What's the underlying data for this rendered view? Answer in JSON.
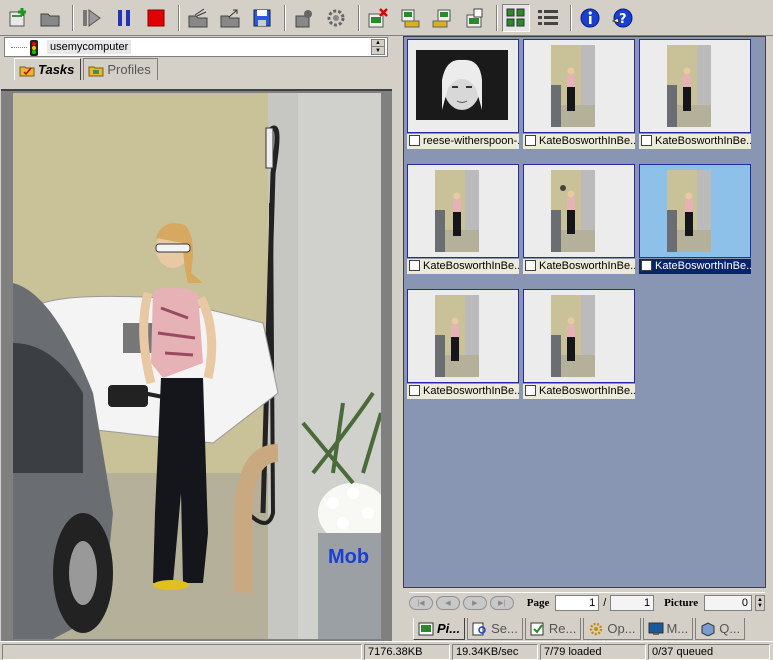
{
  "toolbar": {
    "icons": [
      "new-task-icon",
      "open-folder-icon",
      "play-icon",
      "pause-icon",
      "stop-icon",
      "open-files-icon",
      "export-icon",
      "save-icon",
      "properties-icon",
      "settings-icon",
      "delete-icon",
      "download-icon",
      "upload-icon",
      "copy-icon",
      "thumbnail-view-icon",
      "details-view-icon",
      "info-icon",
      "help-icon"
    ],
    "accent_red": "#e00000",
    "accent_blue": "#1a3fd1"
  },
  "tree": {
    "node_label": "usemycomputer"
  },
  "left_tabs": [
    {
      "label": "Tasks",
      "active": true
    },
    {
      "label": "Profiles",
      "active": false
    }
  ],
  "thumbnails": [
    {
      "caption": "reese-witherspoon-...",
      "selected": false
    },
    {
      "caption": "KateBosworthInBe...",
      "selected": false
    },
    {
      "caption": "KateBosworthInBe...",
      "selected": false
    },
    {
      "caption": "KateBosworthInBe...",
      "selected": false
    },
    {
      "caption": "KateBosworthInBe...",
      "selected": false
    },
    {
      "caption": "KateBosworthInBe...",
      "selected": true
    },
    {
      "caption": "KateBosworthInBe...",
      "selected": false
    },
    {
      "caption": "KateBosworthInBe...",
      "selected": false
    }
  ],
  "pager": {
    "page_label": "Page",
    "page_value": "1",
    "page_total": "1",
    "picture_label": "Picture",
    "picture_value": "0"
  },
  "bottom_tabs": [
    {
      "label": "Pi...",
      "active": true
    },
    {
      "label": "Se...",
      "active": false
    },
    {
      "label": "Re...",
      "active": false
    },
    {
      "label": "Op...",
      "active": false
    },
    {
      "label": "M...",
      "active": false
    },
    {
      "label": "Q...",
      "active": false
    }
  ],
  "status": {
    "size": "7176.38KB",
    "speed": "19.34KB/sec",
    "loaded": "7/79 loaded",
    "queued": "0/37 queued"
  },
  "colors": {
    "grid_bg": "#8896b4",
    "selection": "#0a246a",
    "selected_frame": "#8ec1ea"
  }
}
